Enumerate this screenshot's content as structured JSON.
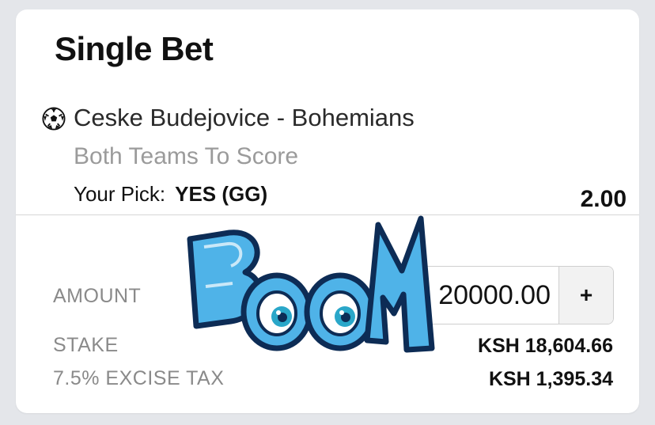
{
  "bet_slip": {
    "title": "Single Bet",
    "event": {
      "icon": "soccer-ball-icon",
      "match": "Ceske Budejovice - Bohemians",
      "market": "Both Teams To Score",
      "pick_label": "Your Pick:",
      "pick_value": "YES (GG)",
      "odds": "2.00"
    },
    "amount": {
      "label": "AMOUNT",
      "value": "20000.00",
      "increment_label": "+"
    },
    "stake": {
      "label": "STAKE",
      "value": "KSH 18,604.66"
    },
    "excise_tax": {
      "label": "7.5% EXCISE TAX",
      "value": "KSH 1,395.34"
    }
  },
  "overlay": {
    "sticker_text": "BOOM",
    "colors": {
      "fill": "#4fb3e8",
      "outline": "#0d2c55"
    }
  }
}
